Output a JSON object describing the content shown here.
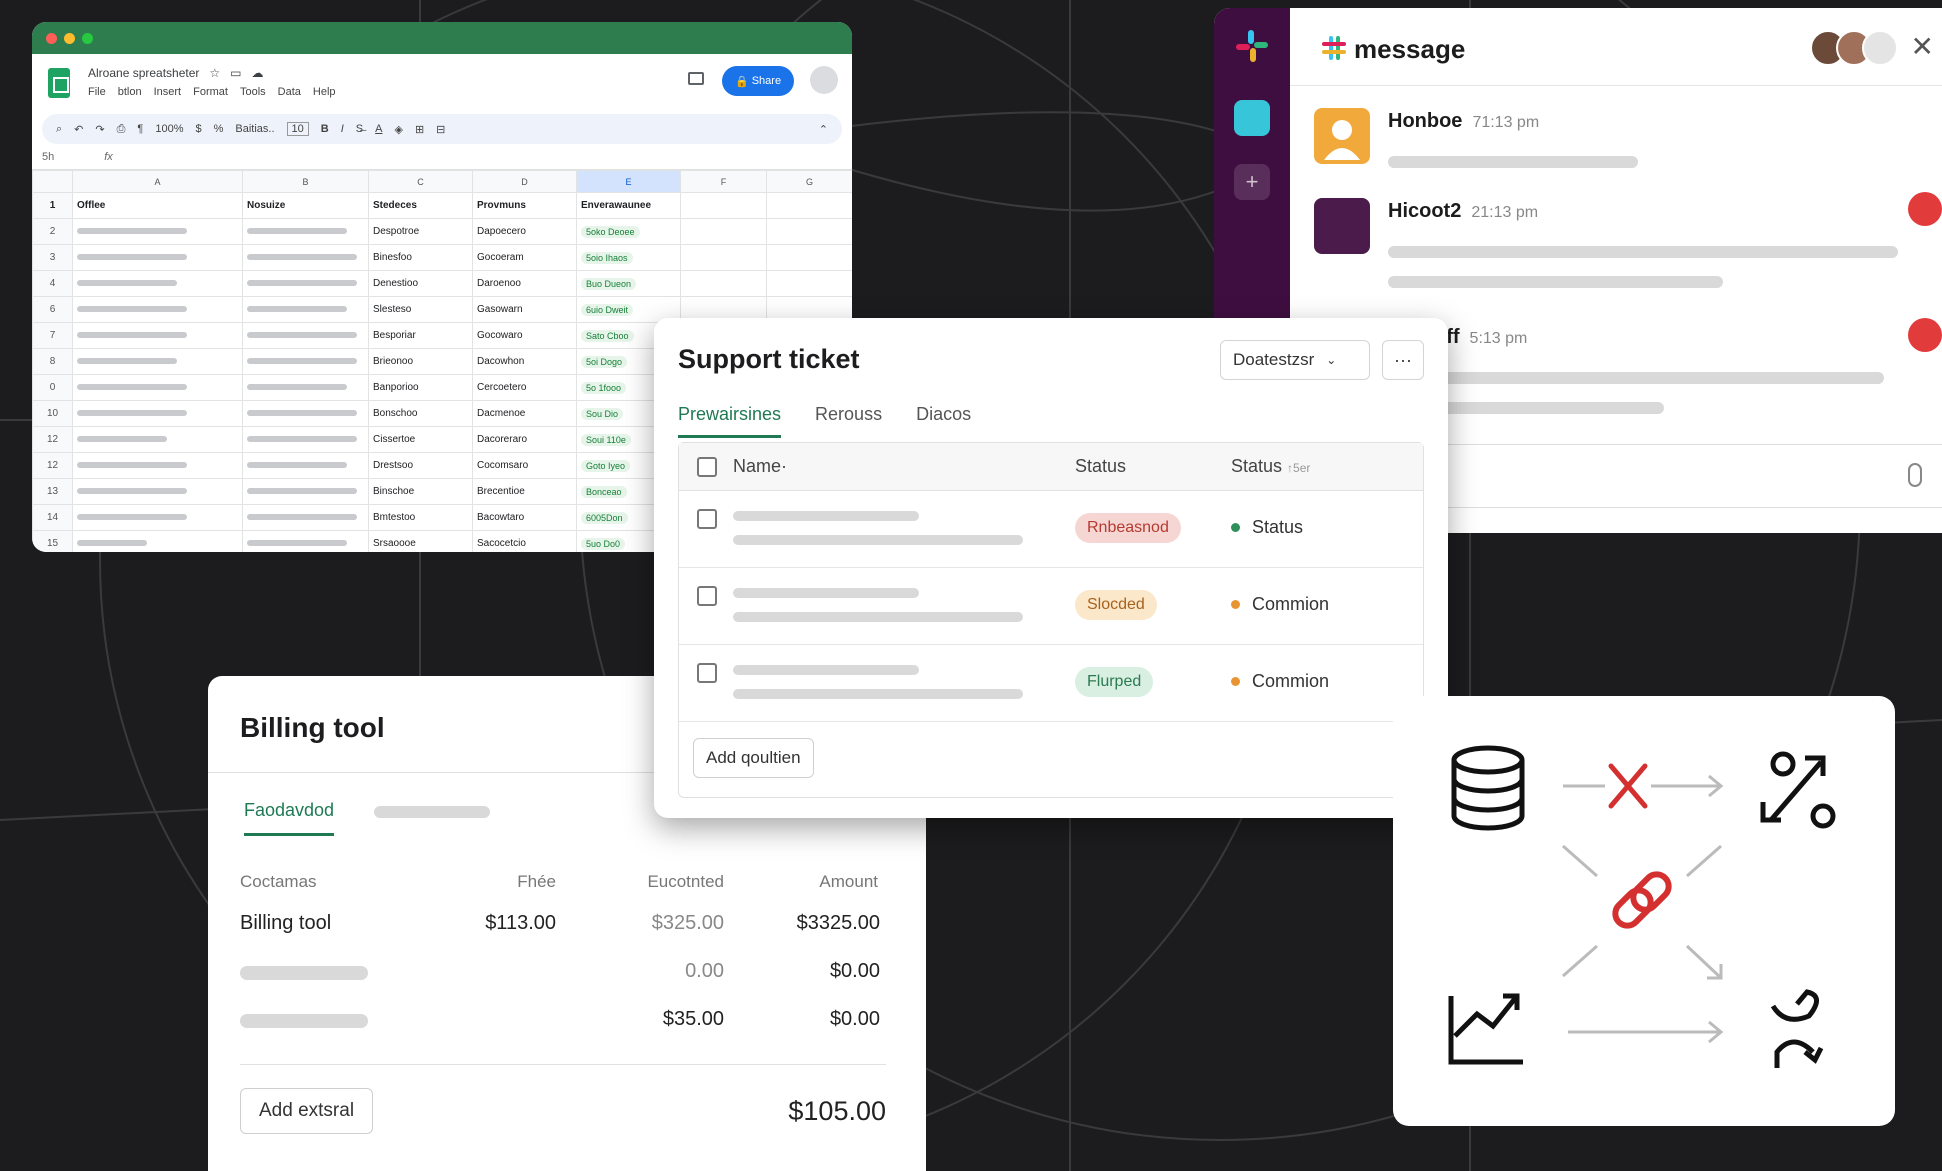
{
  "colors": {
    "background": "#1c1c1e",
    "sheets_green": "#2e7d4f",
    "slack_purple": "#3f0e40",
    "accent_green": "#1f7a54",
    "alert_red": "#e23b3b"
  },
  "spreadsheet": {
    "doc_title": "Alroane spreatsheter",
    "menus": [
      "File",
      "btlon",
      "Insert",
      "Format",
      "Tools",
      "Data",
      "Help"
    ],
    "share_label": "Share",
    "toolbar": {
      "zoom": "100%",
      "font": "Baitias..",
      "font_size": "10"
    },
    "name_box": "5h",
    "fx": "fx",
    "columns": [
      "A",
      "B",
      "C",
      "D",
      "E",
      "F",
      "G"
    ],
    "header_row": {
      "num": "1",
      "a": "Offlee",
      "b": "Nosuize",
      "c": "Stedeces",
      "d": "Provmuns",
      "e": "Enverawaunee"
    },
    "rows": [
      {
        "num": "2",
        "c": "Despotroe",
        "d": "Dapoecero",
        "e": "5oko Deoee"
      },
      {
        "num": "3",
        "c": "Binesfoo",
        "d": "Gocoeram",
        "e": "5oio Ihaos"
      },
      {
        "num": "4",
        "c": "Denestioo",
        "d": "Daroenoo",
        "e": "Buo Dueon"
      },
      {
        "num": "6",
        "c": "Slesteso",
        "d": "Gasowarn",
        "e": "6uio Dweit"
      },
      {
        "num": "7",
        "c": "Besporiar",
        "d": "Gocowaro",
        "e": "Sato Cboo"
      },
      {
        "num": "8",
        "c": "Brieonoo",
        "d": "Dacowhon",
        "e": "5oi Dogo"
      },
      {
        "num": "0",
        "c": "Banporioo",
        "d": "Cercoetero",
        "e": "5o 1fooo"
      },
      {
        "num": "10",
        "c": "Bonschoo",
        "d": "Dacmenoe",
        "e": "Sou Dio"
      },
      {
        "num": "12",
        "c": "Cissertoe",
        "d": "Dacoreraro",
        "e": "Soui 110e"
      },
      {
        "num": "12",
        "c": "Drestsoo",
        "d": "Cocomsaro",
        "e": "Goto Iyeo"
      },
      {
        "num": "13",
        "c": "Binschoe",
        "d": "Brecentioe",
        "e": "Bonceao"
      },
      {
        "num": "14",
        "c": "Bmtestoo",
        "d": "Bacowtaro",
        "e": "6005Don"
      },
      {
        "num": "15",
        "c": "Srsaoooe",
        "d": "Sacocetcio",
        "e": "5uo Do0"
      }
    ]
  },
  "slack": {
    "channel": "message",
    "messages": [
      {
        "name": "Honboe",
        "time": "71:13 pm"
      },
      {
        "name": "Hicoot2",
        "time": "21:13 pm"
      },
      {
        "name": "uff",
        "time": "5:13 pm"
      }
    ]
  },
  "support_ticket": {
    "title": "Support ticket",
    "dropdown": "Doatestzsr",
    "more": "···",
    "tabs": [
      "Prewairsines",
      "Rerouss",
      "Diacos"
    ],
    "columns": {
      "name": "Name·",
      "status1": "Status",
      "status2": "Status",
      "status2_hint": "↑5er"
    },
    "rows": [
      {
        "pill": "Rnbeasnod",
        "pill_bg": "#f6d6d3",
        "pill_fg": "#b53a2f",
        "status": "Status",
        "dot": "#2f8f5b"
      },
      {
        "pill": "Slocded",
        "pill_bg": "#fbe7c9",
        "pill_fg": "#a8621b",
        "status": "Commion",
        "dot": "#e99432"
      },
      {
        "pill": "Flurped",
        "pill_bg": "#d8efe2",
        "pill_fg": "#2b7a52",
        "status": "Commion",
        "dot": "#e99432"
      }
    ],
    "add_button": "Add qoultien"
  },
  "billing": {
    "title": "Billing tool",
    "tab": "Faodavdod",
    "headers": {
      "c1": "Coctamas",
      "c2": "Fhée",
      "c3": "Eucotnted",
      "c4": "Amount"
    },
    "row1": {
      "label": "Billing tool",
      "fee": "$113.00",
      "estimated": "$325.00",
      "amount": "$3325.00"
    },
    "row2": {
      "estimated": "0.00",
      "amount": "$0.00"
    },
    "row3": {
      "estimated": "$35.00",
      "amount": "$0.00"
    },
    "add_button": "Add extsral",
    "total": "$105.00"
  },
  "integration_card": {
    "icons": [
      "database-icon",
      "error-x-icon",
      "link-icon",
      "swap-arrows-icon",
      "trend-chart-icon",
      "refresh-route-icon"
    ]
  }
}
